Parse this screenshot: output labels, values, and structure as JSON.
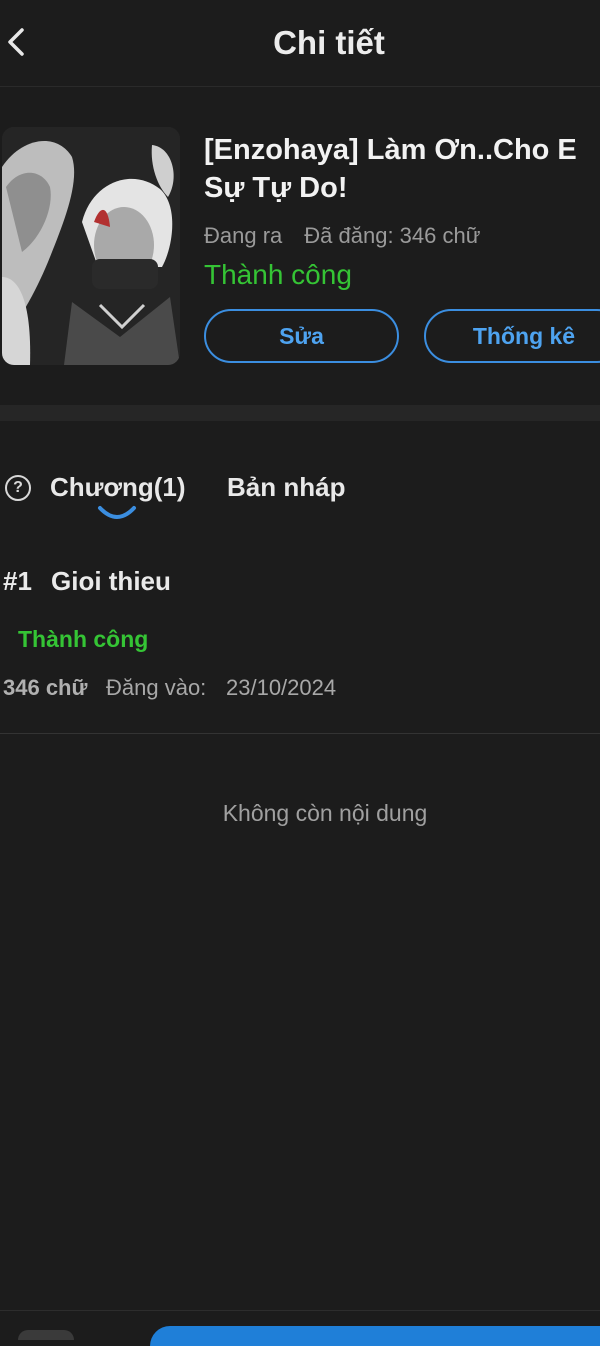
{
  "header": {
    "title": "Chi tiết"
  },
  "book": {
    "title": "[Enzohaya] Làm Ơn..Cho E Sự Tự Do!",
    "progress": "Đang ra",
    "posted_words": "Đã đăng: 346 chữ",
    "status": "Thành công",
    "edit_label": "Sửa",
    "stats_label": "Thống kê"
  },
  "tabs": {
    "chapters_label": "Chương(1)",
    "drafts_label": "Bản nháp"
  },
  "chapters": [
    {
      "number": "#1",
      "title": "Gioi thieu",
      "status": "Thành công",
      "words": "346 chữ",
      "posted_label": "Đăng vào:",
      "posted_date": "23/10/2024"
    }
  ],
  "empty_message": "Không còn nội dung",
  "colors": {
    "accent": "#3b8ee0",
    "success": "#35c435",
    "background": "#1c1c1c"
  },
  "icons": {
    "back": "chevron-left-icon",
    "help": "question-circle-icon"
  }
}
